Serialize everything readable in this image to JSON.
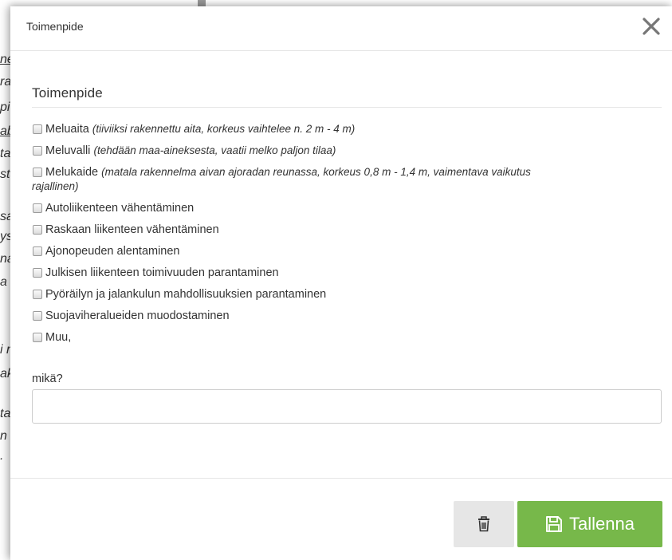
{
  "background_text": [
    "ne",
    "ra",
    "pi",
    "ab",
    "ta",
    "sta",
    "sa",
    "ys",
    "na",
    "a",
    "i r",
    "ak",
    "ta",
    "n",
    "."
  ],
  "modal": {
    "title": "Toimenpide",
    "close_icon": "close-icon"
  },
  "section": {
    "title": "Toimenpide"
  },
  "options": [
    {
      "label": "Meluaita",
      "note": "(tiiviiksi rakennettu aita, korkeus vaihtelee n. 2 m - 4 m)",
      "checked": false
    },
    {
      "label": "Meluvalli",
      "note": "(tehdään maa-aineksesta, vaatii melko paljon tilaa)",
      "checked": false
    },
    {
      "label": "Melukaide",
      "note": "(matala rakennelma aivan ajoradan reunassa, korkeus 0,8 m - 1,4 m, vaimentava vaikutus",
      "note_cont": "rajallinen)",
      "checked": false
    },
    {
      "label": "Autoliikenteen vähentäminen",
      "checked": false
    },
    {
      "label": "Raskaan liikenteen vähentäminen",
      "checked": false
    },
    {
      "label": "Ajonopeuden alentaminen",
      "checked": false
    },
    {
      "label": "Julkisen liikenteen toimivuuden parantaminen",
      "checked": false
    },
    {
      "label": "Pyöräilyn ja jalankulun mahdollisuuksien parantaminen",
      "checked": false
    },
    {
      "label": "Suojaviheralueiden muodostaminen",
      "checked": false
    },
    {
      "label": "Muu,",
      "checked": false
    }
  ],
  "other_field": {
    "label": "mikä?",
    "value": "",
    "placeholder": ""
  },
  "footer": {
    "delete_icon": "trash-icon",
    "save_icon": "save-icon",
    "save_label": "Tallenna"
  },
  "colors": {
    "save_button": "#77b84a",
    "delete_button": "#e6e6e6"
  }
}
